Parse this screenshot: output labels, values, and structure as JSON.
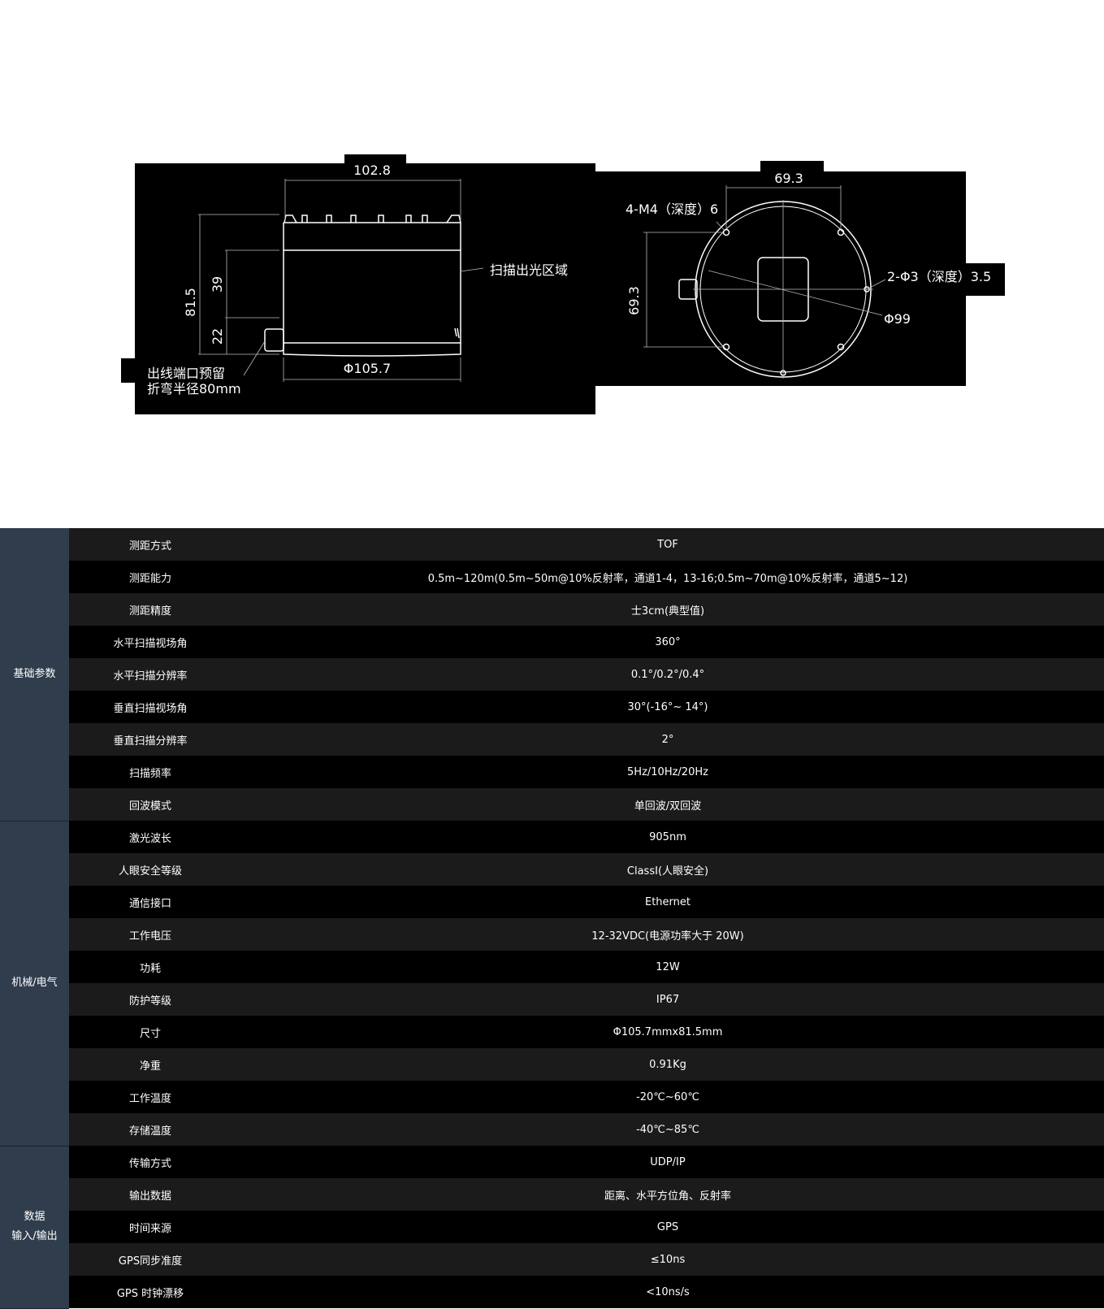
{
  "drawing_side": {
    "dim_width": "102.8",
    "dim_height_total": "81.5",
    "dim_upper": "39",
    "dim_lower": "22",
    "dim_diameter": "Φ105.7",
    "label_scan_area": "扫描出光区域",
    "label_port_line1": "出线端口预留",
    "label_port_line2": "折弯半径80mm"
  },
  "drawing_top": {
    "dim_horizontal": "69.3",
    "dim_vertical": "69.3",
    "label_m4": "4-M4（深度）6",
    "label_phi3": "2-Φ3（深度）3.5",
    "label_phi99": "Φ99"
  },
  "spec_table": {
    "groups": [
      {
        "category_lines": [
          "基础参数"
        ],
        "rows": [
          {
            "name": "测距方式",
            "value": "TOF"
          },
          {
            "name": "测距能力",
            "value": "0.5m~120m(0.5m~50m@10%反射率，通道1-4，13-16;0.5m~70m@10%反射率，通道5~12)"
          },
          {
            "name": "测距精度",
            "value": "士3cm(典型值)"
          },
          {
            "name": "水平扫描视场角",
            "value": "360°"
          },
          {
            "name": "水平扫描分辨率",
            "value": "0.1°/0.2°/0.4°"
          },
          {
            "name": "垂直扫描视场角",
            "value": "30°(-16°~ 14°)"
          },
          {
            "name": "垂直扫描分辨率",
            "value": "2°"
          },
          {
            "name": "扫描频率",
            "value": "5Hz/10Hz/20Hz"
          },
          {
            "name": "回波模式",
            "value": "单回波/双回波"
          }
        ]
      },
      {
        "category_lines": [
          "机械/电气"
        ],
        "rows": [
          {
            "name": "激光波长",
            "value": "905nm"
          },
          {
            "name": "人眼安全等级",
            "value": "ClassI(人眼安全)"
          },
          {
            "name": "通信接口",
            "value": "Ethernet"
          },
          {
            "name": "工作电压",
            "value": "12-32VDC(电源功率大于 20W)"
          },
          {
            "name": "功耗",
            "value": "12W"
          },
          {
            "name": "防护等级",
            "value": "IP67"
          },
          {
            "name": "尺寸",
            "value": "Φ105.7mmx81.5mm"
          },
          {
            "name": "净重",
            "value": "0.91Kg"
          },
          {
            "name": "工作温度",
            "value": "-20℃~60℃"
          },
          {
            "name": "存储温度",
            "value": "-40℃~85℃"
          }
        ]
      },
      {
        "category_lines": [
          "数据",
          "输入/输出"
        ],
        "rows": [
          {
            "name": "传输方式",
            "value": "UDP/IP"
          },
          {
            "name": "输出数据",
            "value": "距离、水平方位角、反射率"
          },
          {
            "name": "时间来源",
            "value": "GPS"
          },
          {
            "name": "GPS同步准度",
            "value": "≤10ns"
          },
          {
            "name": "GPS 时钟漂移",
            "value": "<10ns/s"
          }
        ]
      }
    ]
  },
  "colors": {
    "page_background": "#ffffff",
    "drawing_background": "#000000",
    "category_cell": "#2f3d4d",
    "row_even": "#1b1b1b",
    "row_odd": "#000000",
    "text": "#ffffff"
  }
}
